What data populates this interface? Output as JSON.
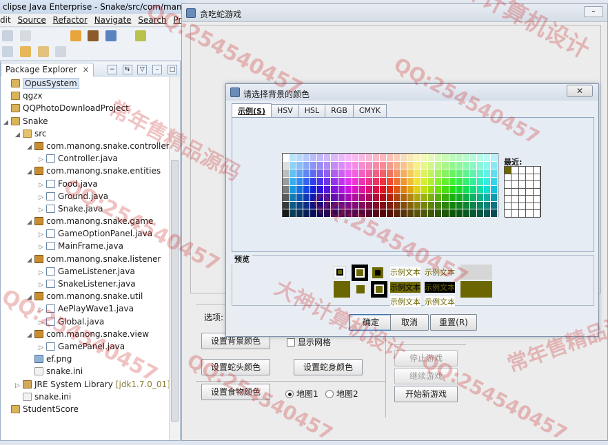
{
  "eclipse": {
    "title": "clipse Java Enterprise - Snake/src/com/manong/sn",
    "menu": [
      "dit",
      "Source",
      "Refactor",
      "Navigate",
      "Search",
      "Pro"
    ],
    "package_explorer": {
      "tab_label": "Package Explorer",
      "close": "×",
      "tree": [
        {
          "label": "OpusSystem",
          "icon": "project-icon",
          "indent": 0,
          "twisty": "",
          "selected": true
        },
        {
          "label": "qgzx",
          "icon": "project-icon",
          "indent": 0,
          "twisty": ""
        },
        {
          "label": "QQPhotoDownloadProject",
          "icon": "project-icon",
          "indent": 0,
          "twisty": ""
        },
        {
          "label": "Snake",
          "icon": "project-icon",
          "indent": 0,
          "twisty": "◢"
        },
        {
          "label": "src",
          "icon": "source-folder-icon",
          "indent": 1,
          "twisty": "◢"
        },
        {
          "label": "com.manong.snake.controller",
          "icon": "package-icon",
          "indent": 2,
          "twisty": "◢"
        },
        {
          "label": "Controller.java",
          "icon": "java-file-icon",
          "indent": 3,
          "twisty": "▷"
        },
        {
          "label": "com.manong.snake.entities",
          "icon": "package-icon",
          "indent": 2,
          "twisty": "◢"
        },
        {
          "label": "Food.java",
          "icon": "java-file-icon",
          "indent": 3,
          "twisty": "▷"
        },
        {
          "label": "Ground.java",
          "icon": "java-file-icon",
          "indent": 3,
          "twisty": "▷"
        },
        {
          "label": "Snake.java",
          "icon": "java-file-icon",
          "indent": 3,
          "twisty": "▷"
        },
        {
          "label": "com.manong.snake.game",
          "icon": "package-icon",
          "indent": 2,
          "twisty": "◢"
        },
        {
          "label": "GameOptionPanel.java",
          "icon": "java-file-icon",
          "indent": 3,
          "twisty": "▷"
        },
        {
          "label": "MainFrame.java",
          "icon": "java-file-icon",
          "indent": 3,
          "twisty": "▷"
        },
        {
          "label": "com.manong.snake.listener",
          "icon": "package-icon",
          "indent": 2,
          "twisty": "◢"
        },
        {
          "label": "GameListener.java",
          "icon": "java-file-icon",
          "indent": 3,
          "twisty": "▷"
        },
        {
          "label": "SnakeListener.java",
          "icon": "java-file-icon",
          "indent": 3,
          "twisty": "▷"
        },
        {
          "label": "com.manong.snake.util",
          "icon": "package-icon",
          "indent": 2,
          "twisty": "◢"
        },
        {
          "label": "AePlayWave1.java",
          "icon": "java-file-icon",
          "indent": 3,
          "twisty": "▷"
        },
        {
          "label": "Global.java",
          "icon": "java-file-icon",
          "indent": 3,
          "twisty": "▷"
        },
        {
          "label": "com.manong.snake.view",
          "icon": "package-icon",
          "indent": 2,
          "twisty": "◢"
        },
        {
          "label": "GamePanel.java",
          "icon": "java-file-icon",
          "indent": 3,
          "twisty": "▷"
        },
        {
          "label": "ef.png",
          "icon": "image-file-icon",
          "indent": 2,
          "twisty": ""
        },
        {
          "label": "snake.ini",
          "icon": "ini-file-icon",
          "indent": 2,
          "twisty": ""
        },
        {
          "label": "JRE System Library",
          "extra": "[jdk1.7.0_01]",
          "icon": "library-icon",
          "indent": 1,
          "twisty": "▷"
        },
        {
          "label": "snake.ini",
          "icon": "ini-file-icon",
          "indent": 1,
          "twisty": ""
        },
        {
          "label": "StudentScore",
          "icon": "project-icon",
          "indent": 0,
          "twisty": ""
        }
      ]
    }
  },
  "game": {
    "title": "贪吃蛇游戏",
    "options_label": "选项:",
    "buttons": {
      "bg_color": "设置背景颜色",
      "head_color": "设置蛇头颜色",
      "body_color": "设置蛇身颜色",
      "food_color": "设置食物颜色",
      "pause": "停止游戏",
      "resume": "继续游戏",
      "new_game": "开始新游戏"
    },
    "show_grid": "显示网格",
    "map1": "地图1",
    "map2": "地图2"
  },
  "dialog": {
    "title": "请选择背景的颜色",
    "close": "✕",
    "tabs": [
      "示例(S)",
      "HSV",
      "HSL",
      "RGB",
      "CMYK"
    ],
    "recent_label": "最近:",
    "preview_label": "预览",
    "sample_text": "示例文本",
    "preview_color": "#6b6600",
    "buttons": {
      "ok": "确定",
      "cancel": "取消",
      "reset": "重置(R)"
    }
  },
  "watermarks": [
    "大神计算机设计",
    "QQ:254540457",
    "常年售精品源码"
  ]
}
